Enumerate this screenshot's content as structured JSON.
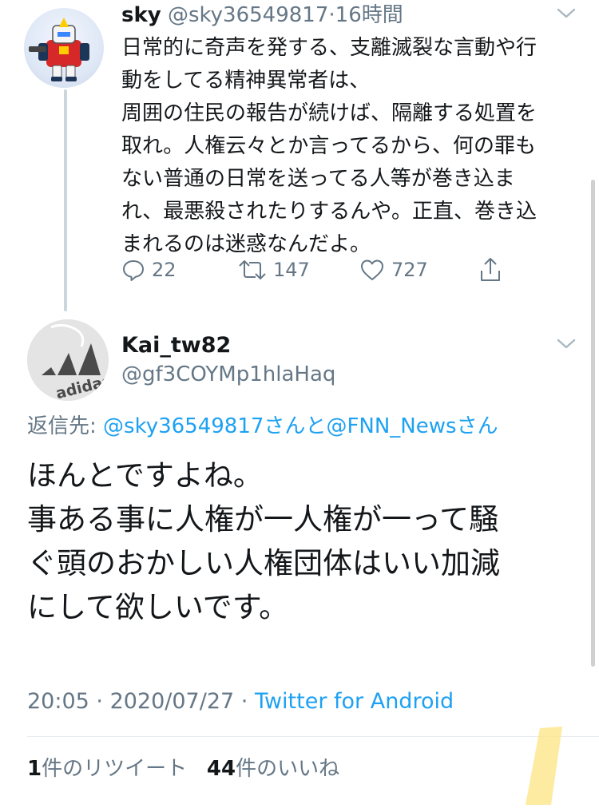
{
  "parent_tweet": {
    "display_name": "sky",
    "handle": "@sky36549817",
    "separator": "·",
    "time_ago": "16時間",
    "text_lines": [
      "日常的に奇声を発する、支離滅裂な言動や行",
      "動をしてる精神異常者は、",
      "周囲の住民の報告が続けば、隔離する処置を",
      "取れ。人権云々とか言ってるから、何の罪も",
      "ない普通の日常を送ってる人等が巻き込ま",
      "れ、最悪殺されたりするんや。正直、巻き込",
      "まれるのは迷惑なんだよ。"
    ],
    "reply_count": "22",
    "retweet_count": "147",
    "like_count": "727"
  },
  "reply_tweet": {
    "display_name": "Kai_tw82",
    "handle": "@gf3COYMp1hlaHaq",
    "avatar_text": "adidas",
    "replying_label": "返信先: ",
    "replying_to_1": "@sky36549817さん",
    "replying_joiner": "と",
    "replying_to_2": "@FNN_Newsさん",
    "text_lines": [
      "ほんとですよね。",
      "事ある事に人権が一人権が一って騒",
      "ぐ頭のおかしい人権団体はいい加減",
      "にして欲しいです。"
    ],
    "time": "20:05",
    "sep": " · ",
    "date": "2020/07/27",
    "sep2": " · ",
    "client": "Twitter for Android",
    "retweets_num": "1",
    "retweets_label": "件のリツイート",
    "likes_num": "44",
    "likes_label": "件のいいね"
  },
  "colors": {
    "link": "#1da1f2",
    "muted": "#657786",
    "text": "#14171a",
    "divider": "#e6ecf0"
  },
  "icons": [
    "chevron-down-icon",
    "reply-icon",
    "retweet-icon",
    "like-icon",
    "share-icon"
  ]
}
